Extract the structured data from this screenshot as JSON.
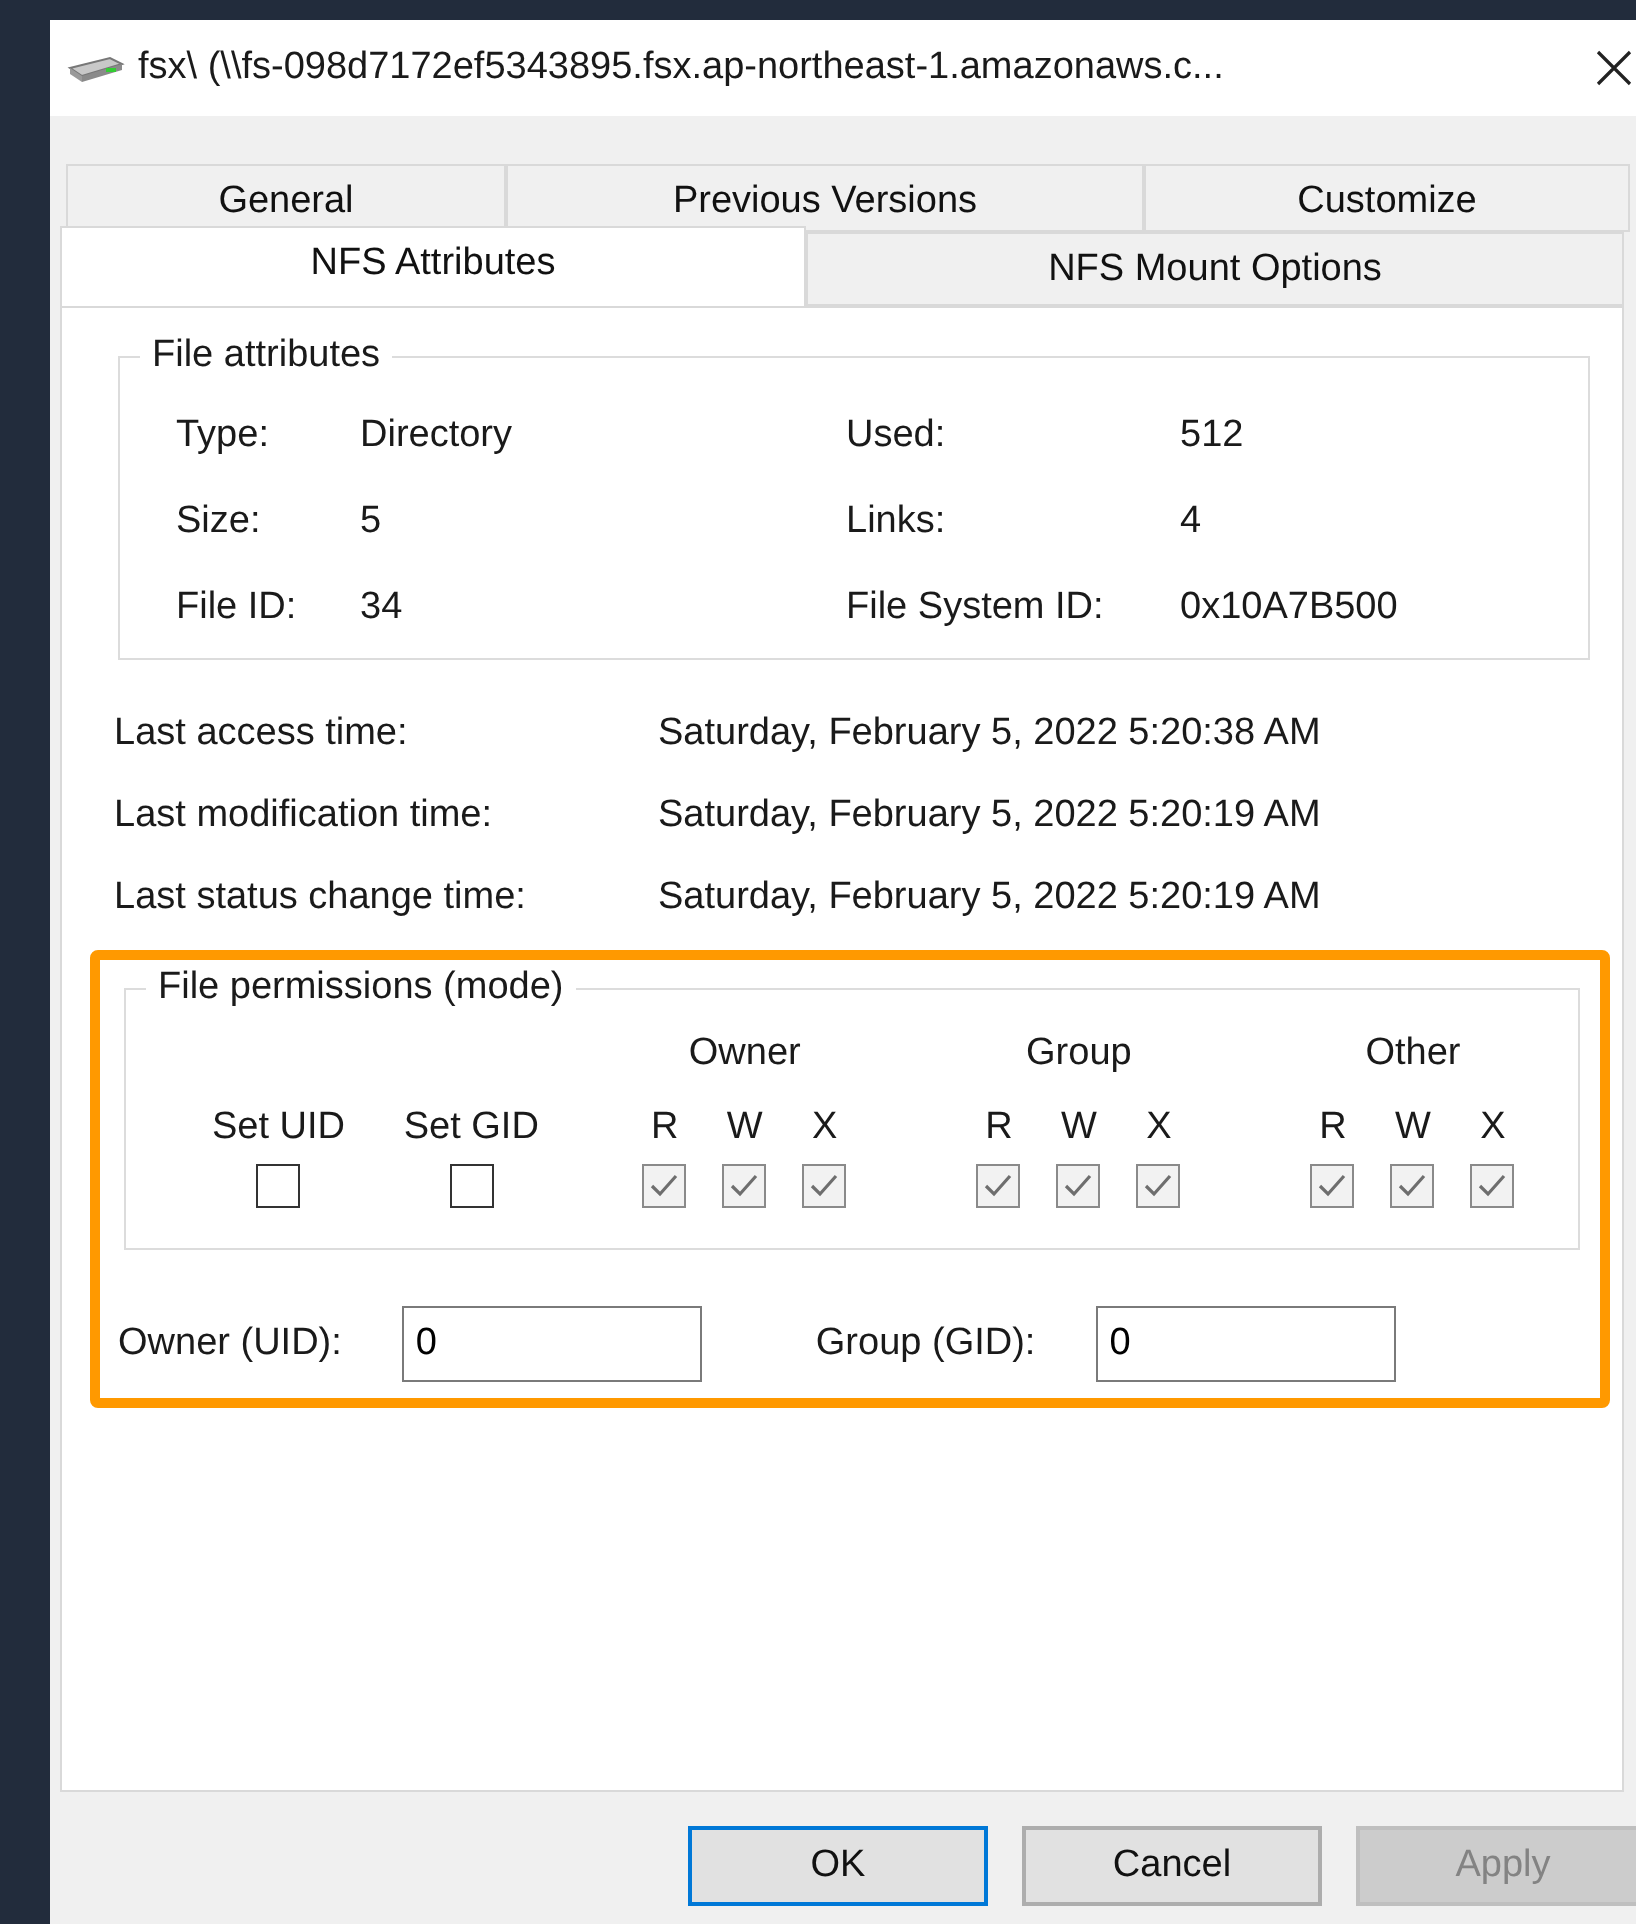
{
  "window": {
    "title": "fsx\\ (\\\\fs-098d7172ef5343895.fsx.ap-northeast-1.amazonaws.c..."
  },
  "tabs": [
    [
      {
        "label": "General",
        "selected": false
      },
      {
        "label": "Previous Versions",
        "selected": false
      },
      {
        "label": "Customize",
        "selected": false
      }
    ],
    [
      {
        "label": "NFS Attributes",
        "selected": true
      },
      {
        "label": "NFS Mount Options",
        "selected": false
      }
    ]
  ],
  "file_attributes": {
    "title": "File attributes",
    "fields": [
      {
        "label": "Type:",
        "value": "Directory"
      },
      {
        "label": "Used:",
        "value": "512"
      },
      {
        "label": "Size:",
        "value": "5"
      },
      {
        "label": "Links:",
        "value": "4"
      },
      {
        "label": "File ID:",
        "value": "34"
      },
      {
        "label": "File System ID:",
        "value": "0x10A7B500"
      }
    ]
  },
  "times": [
    {
      "label": "Last access time:",
      "value": "Saturday, February 5, 2022 5:20:38 AM"
    },
    {
      "label": "Last modification time:",
      "value": "Saturday, February 5, 2022 5:20:19 AM"
    },
    {
      "label": "Last status change time:",
      "value": "Saturday, February 5, 2022 5:20:19 AM"
    }
  ],
  "highlight": {
    "color": "#ff9900"
  },
  "permissions": {
    "title": "File permissions (mode)",
    "special": [
      {
        "label": "Set UID",
        "checked": false,
        "disabled": false
      },
      {
        "label": "Set GID",
        "checked": false,
        "disabled": false
      }
    ],
    "groups": [
      {
        "name": "Owner",
        "bits": [
          {
            "label": "R",
            "checked": true,
            "disabled": true
          },
          {
            "label": "W",
            "checked": true,
            "disabled": true
          },
          {
            "label": "X",
            "checked": true,
            "disabled": true
          }
        ]
      },
      {
        "name": "Group",
        "bits": [
          {
            "label": "R",
            "checked": true,
            "disabled": true
          },
          {
            "label": "W",
            "checked": true,
            "disabled": true
          },
          {
            "label": "X",
            "checked": true,
            "disabled": true
          }
        ]
      },
      {
        "name": "Other",
        "bits": [
          {
            "label": "R",
            "checked": true,
            "disabled": true
          },
          {
            "label": "W",
            "checked": true,
            "disabled": true
          },
          {
            "label": "X",
            "checked": true,
            "disabled": true
          }
        ]
      }
    ]
  },
  "ids": [
    {
      "label": "Owner (UID):",
      "value": "0"
    },
    {
      "label": "Group (GID):",
      "value": "0"
    }
  ],
  "buttons": [
    {
      "label": "OK",
      "default": true,
      "disabled": false
    },
    {
      "label": "Cancel",
      "default": false,
      "disabled": false
    },
    {
      "label": "Apply",
      "default": false,
      "disabled": true
    }
  ]
}
